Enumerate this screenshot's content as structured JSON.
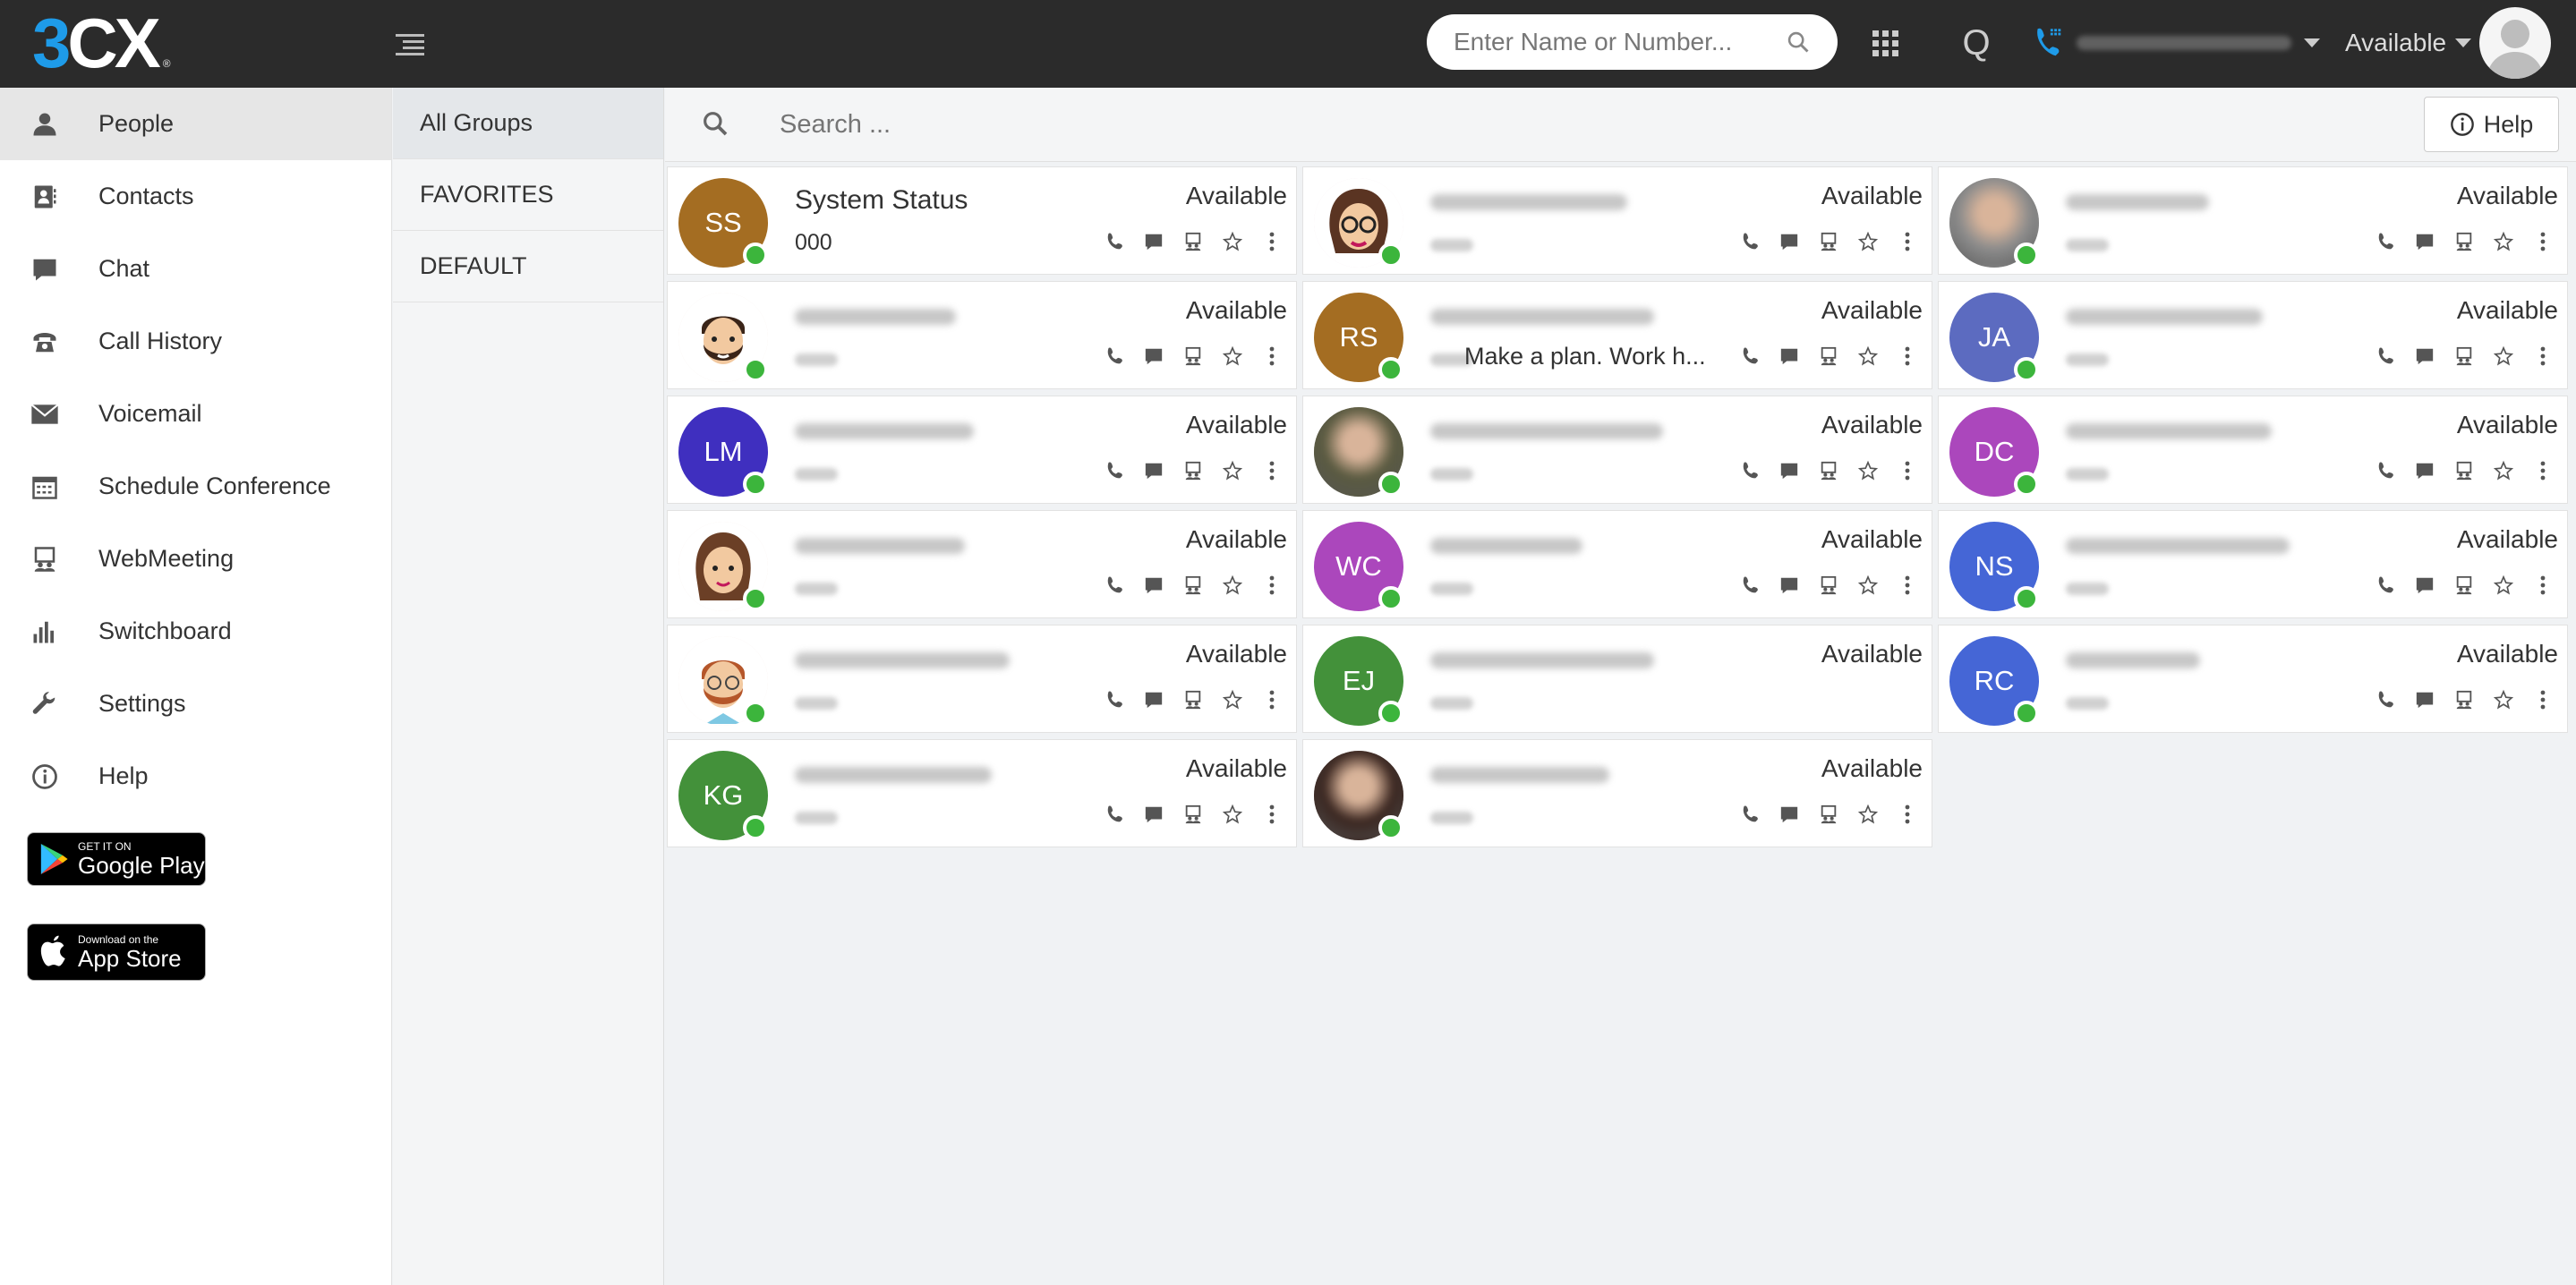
{
  "header": {
    "logo": {
      "part1": "3",
      "part2": "CX",
      "reg": "®"
    },
    "dial_placeholder": "Enter Name or Number...",
    "q_label": "Q",
    "status": "Available"
  },
  "sidebar": {
    "items": [
      {
        "label": "People",
        "icon": "person-icon"
      },
      {
        "label": "Contacts",
        "icon": "contacts-icon"
      },
      {
        "label": "Chat",
        "icon": "chat-icon"
      },
      {
        "label": "Call History",
        "icon": "phone-icon"
      },
      {
        "label": "Voicemail",
        "icon": "voicemail-icon"
      },
      {
        "label": "Schedule Conference",
        "icon": "calendar-icon"
      },
      {
        "label": "WebMeeting",
        "icon": "webmeeting-icon"
      },
      {
        "label": "Switchboard",
        "icon": "switchboard-icon"
      },
      {
        "label": "Settings",
        "icon": "wrench-icon"
      },
      {
        "label": "Help",
        "icon": "info-icon"
      }
    ],
    "google_play": {
      "small": "GET IT ON",
      "big": "Google Play"
    },
    "app_store": {
      "small": "Download on the",
      "big": "App Store"
    }
  },
  "groups": [
    "All Groups",
    "FAVORITES",
    "DEFAULT"
  ],
  "search": {
    "placeholder": "Search ..."
  },
  "help_label": "Help",
  "colors": {
    "header_bg": "#2b2b2b",
    "brand_blue": "#1e9be9",
    "online_green": "#3cb53c"
  },
  "contacts": [
    {
      "initials": "SS",
      "name": "System Status",
      "ext": "000",
      "status": "Available",
      "color": "#a46d22",
      "note": ""
    },
    {
      "initials": "",
      "name": "",
      "ext": "",
      "status": "Available",
      "color": "#f0e0e6",
      "note": ""
    },
    {
      "initials": "",
      "name": "",
      "ext": "",
      "status": "Available",
      "color": "#8c8c8c",
      "note": ""
    },
    {
      "initials": "",
      "name": "",
      "ext": "",
      "status": "Available",
      "color": "#f4e4da",
      "note": ""
    },
    {
      "initials": "RS",
      "name": "",
      "ext": "",
      "status": "Available",
      "color": "#a46d22",
      "note": "Make a plan. Work h..."
    },
    {
      "initials": "JA",
      "name": "",
      "ext": "",
      "status": "Available",
      "color": "#5c6bc0",
      "note": ""
    },
    {
      "initials": "LM",
      "name": "",
      "ext": "",
      "status": "Available",
      "color": "#3f2fbf",
      "note": ""
    },
    {
      "initials": "",
      "name": "",
      "ext": "",
      "status": "Available",
      "color": "#5a5a40",
      "note": ""
    },
    {
      "initials": "DC",
      "name": "",
      "ext": "",
      "status": "Available",
      "color": "#ab47bc",
      "note": ""
    },
    {
      "initials": "",
      "name": "",
      "ext": "",
      "status": "Available",
      "color": "#f2e2da",
      "note": ""
    },
    {
      "initials": "WC",
      "name": "",
      "ext": "",
      "status": "Available",
      "color": "#ab47bc",
      "note": ""
    },
    {
      "initials": "NS",
      "name": "",
      "ext": "",
      "status": "Available",
      "color": "#4566d6",
      "note": ""
    },
    {
      "initials": "",
      "name": "",
      "ext": "",
      "status": "Available",
      "color": "#f2e2da",
      "note": ""
    },
    {
      "initials": "EJ",
      "name": "",
      "ext": "",
      "status": "Available",
      "color": "#43913a",
      "note": ""
    },
    {
      "initials": "RC",
      "name": "",
      "ext": "",
      "status": "Available",
      "color": "#4566d6",
      "note": ""
    },
    {
      "initials": "KG",
      "name": "",
      "ext": "",
      "status": "Available",
      "color": "#43913a",
      "note": ""
    },
    {
      "initials": "",
      "name": "",
      "ext": "",
      "status": "Available",
      "color": "#3a2620",
      "note": ""
    }
  ]
}
